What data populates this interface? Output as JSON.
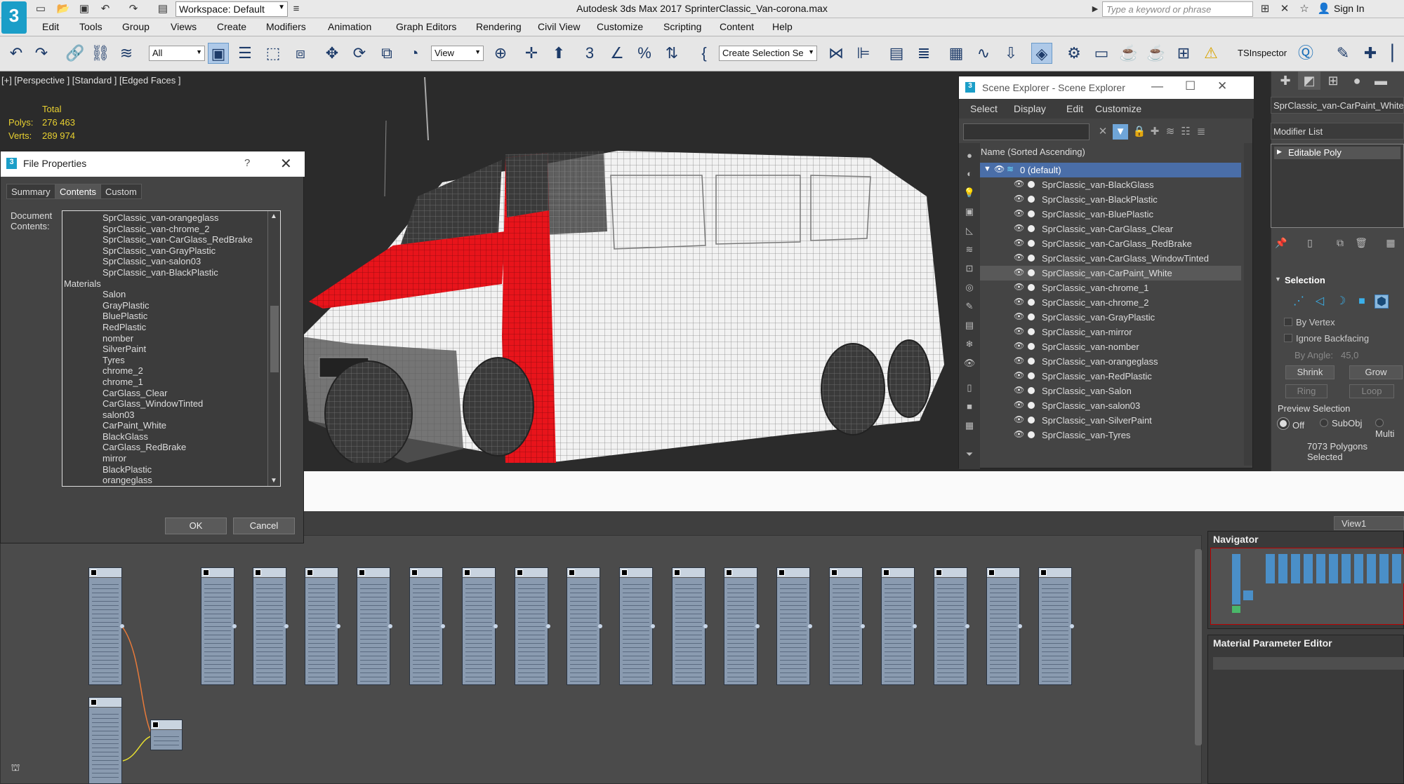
{
  "titlebar": {
    "logo_text": "3",
    "workspace": "Workspace: Default",
    "window_title": "Autodesk 3ds Max 2017    SprinterClassic_Van-corona.max",
    "search_placeholder": "Type a keyword or phrase",
    "signin": "Sign In"
  },
  "menu": [
    "Edit",
    "Tools",
    "Group",
    "Views",
    "Create",
    "Modifiers",
    "Animation",
    "Graph Editors",
    "Rendering",
    "Civil View",
    "Customize",
    "Scripting",
    "Content",
    "Help"
  ],
  "toolbar": {
    "filter_dropdown": "All",
    "refcoord_dropdown": "View",
    "selection_set": "Create Selection Se",
    "tsinspector": "TSInspector"
  },
  "viewport": {
    "label": "[+] [Perspective ] [Standard ] [Edged Faces ]",
    "stats_header": "Total",
    "polys_label": "Polys:",
    "polys_value": "276 463",
    "verts_label": "Verts:",
    "verts_value": "289 974"
  },
  "file_properties": {
    "title": "File Properties",
    "help": "?",
    "tabs": [
      "Summary",
      "Contents",
      "Custom"
    ],
    "active_tab": "Contents",
    "doc_label": "Document\nContents:",
    "list": [
      {
        "text": "SprClassic_van-orangeglass",
        "header": false
      },
      {
        "text": "SprClassic_van-chrome_2",
        "header": false
      },
      {
        "text": "SprClassic_van-CarGlass_RedBrake",
        "header": false
      },
      {
        "text": "SprClassic_van-GrayPlastic",
        "header": false
      },
      {
        "text": "SprClassic_van-salon03",
        "header": false
      },
      {
        "text": "SprClassic_van-BlackPlastic",
        "header": false
      },
      {
        "text": "Materials",
        "header": true
      },
      {
        "text": "Salon",
        "header": false
      },
      {
        "text": "GrayPlastic",
        "header": false
      },
      {
        "text": "BluePlastic",
        "header": false
      },
      {
        "text": "RedPlastic",
        "header": false
      },
      {
        "text": "nomber",
        "header": false
      },
      {
        "text": "SilverPaint",
        "header": false
      },
      {
        "text": "Tyres",
        "header": false
      },
      {
        "text": "chrome_2",
        "header": false
      },
      {
        "text": "chrome_1",
        "header": false
      },
      {
        "text": "CarGlass_Clear",
        "header": false
      },
      {
        "text": "CarGlass_WindowTinted",
        "header": false
      },
      {
        "text": "salon03",
        "header": false
      },
      {
        "text": "CarPaint_White",
        "header": false
      },
      {
        "text": "BlackGlass",
        "header": false
      },
      {
        "text": "CarGlass_RedBrake",
        "header": false
      },
      {
        "text": "mirror",
        "header": false
      },
      {
        "text": "BlackPlastic",
        "header": false
      },
      {
        "text": "orangeglass",
        "header": false
      }
    ],
    "ok": "OK",
    "cancel": "Cancel"
  },
  "scene_explorer": {
    "title": "Scene Explorer - Scene Explorer",
    "menu": [
      "Select",
      "Display",
      "Edit",
      "Customize"
    ],
    "column_header": "Name (Sorted Ascending)",
    "root": "0 (default)",
    "objects": [
      "SprClassic_van-BlackGlass",
      "SprClassic_van-BlackPlastic",
      "SprClassic_van-BluePlastic",
      "SprClassic_van-CarGlass_Clear",
      "SprClassic_van-CarGlass_RedBrake",
      "SprClassic_van-CarGlass_WindowTinted",
      "SprClassic_van-CarPaint_White",
      "SprClassic_van-chrome_1",
      "SprClassic_van-chrome_2",
      "SprClassic_van-GrayPlastic",
      "SprClassic_van-mirror",
      "SprClassic_van-nomber",
      "SprClassic_van-orangeglass",
      "SprClassic_van-RedPlastic",
      "SprClassic_van-Salon",
      "SprClassic_van-salon03",
      "SprClassic_van-SilverPaint",
      "SprClassic_van-Tyres"
    ],
    "selected_object": "SprClassic_van-CarPaint_White"
  },
  "command_panel": {
    "object_name": "SprClassic_van-CarPaint_White",
    "modifier_list": "Modifier List",
    "stack_item": "Editable Poly",
    "selection_title": "Selection",
    "by_vertex": "By Vertex",
    "ignore_backfacing": "Ignore Backfacing",
    "by_angle_label": "By Angle:",
    "by_angle_value": "45,0",
    "shrink": "Shrink",
    "grow": "Grow",
    "ring": "Ring",
    "loop": "Loop",
    "preview_selection": "Preview Selection",
    "radio_off": "Off",
    "radio_subobj": "SubObj",
    "radio_multi": "Multi",
    "polygons_selected": "7073 Polygons Selected"
  },
  "slate": {
    "view_tab": "View1",
    "navigator": "Navigator",
    "parameter_editor": "Material Parameter Editor"
  },
  "colors": {
    "accent_blue": "#1b9ec8",
    "selection_red": "#e8141b",
    "stats_yellow": "#e8d030"
  }
}
